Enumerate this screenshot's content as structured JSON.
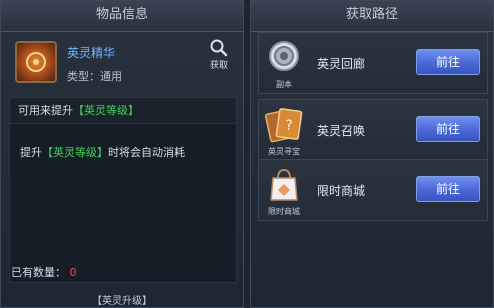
{
  "left_panel": {
    "title": "物品信息",
    "item": {
      "name": "英灵精华",
      "type_text": "类型：通用",
      "icon": "orange-essence-orb-icon"
    },
    "obtain_label": "获取",
    "description": {
      "line1_prefix": "可用来提升",
      "line1_highlight": "【英灵等级】",
      "line2_prefix": "提升",
      "line2_highlight": "【英灵等级】",
      "line2_suffix": "时将会自动消耗"
    },
    "quantity_label": "已有数量：",
    "quantity_value": "0",
    "footer": "【英灵升级】"
  },
  "right_panel": {
    "title": "获取路径",
    "sources": [
      {
        "label": "英灵回廊",
        "icon_caption": "副本",
        "icon": "portal-icon",
        "button": "前往"
      },
      {
        "label": "英灵召唤",
        "icon_caption": "英灵寻宝",
        "icon": "treasure-card-icon",
        "button": "前往"
      },
      {
        "label": "限时商城",
        "icon_caption": "限时商城",
        "icon": "shopping-bag-icon",
        "button": "前往"
      }
    ]
  },
  "colors": {
    "highlight_green": "#40d05a",
    "quantity_red": "#ff4a4a",
    "item_name_blue": "#6fb5ff",
    "button_blue": "#4a68d6"
  }
}
